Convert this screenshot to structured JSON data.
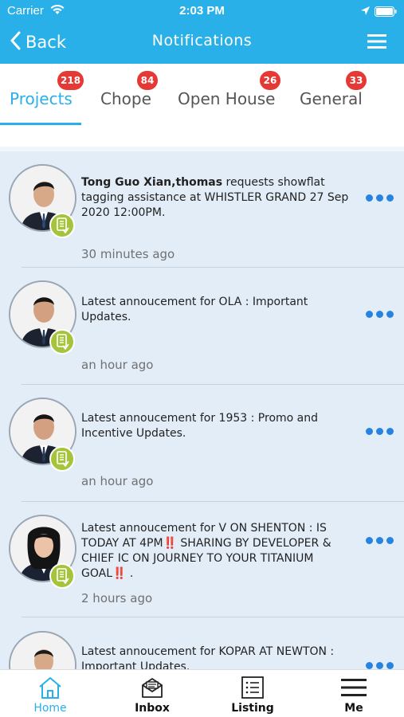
{
  "status_bar": {
    "carrier": "Carrier",
    "time": "2:03 PM"
  },
  "nav": {
    "back_label": "Back",
    "title": "Notifications"
  },
  "tabs": [
    {
      "label": "Projects",
      "badge": "218",
      "active": true
    },
    {
      "label": "Chope",
      "badge": "84",
      "active": false
    },
    {
      "label": "Open House",
      "badge": "26",
      "active": false
    },
    {
      "label": "General",
      "badge": "33",
      "active": false
    }
  ],
  "notifications": [
    {
      "bold": "Tong Guo Xian,thomas",
      "text": " requests showflat tagging assistance at WHISTLER GRAND 27 Sep 2020 12:00PM.",
      "time": "30 minutes ago"
    },
    {
      "bold": "",
      "text": "Latest annoucement for OLA : Important Updates.",
      "time": "an hour ago"
    },
    {
      "bold": "",
      "text": "Latest annoucement for 1953 : Promo and Incentive Updates.",
      "time": "an hour ago"
    },
    {
      "bold": "",
      "text": "Latest annoucement for V ON SHENTON : IS TODAY AT 4PM‼️ SHARING BY DEVELOPER & CHIEF IC ON JOURNEY TO YOUR TITANIUM GOAL‼️ .",
      "time": "2 hours ago"
    },
    {
      "bold": "",
      "text": "Latest annoucement for KOPAR AT NEWTON : Important Updates.",
      "time": ""
    }
  ],
  "bottom_nav": [
    {
      "label": "Home",
      "icon": "home-icon",
      "active": true
    },
    {
      "label": "Inbox",
      "icon": "inbox-icon",
      "active": false
    },
    {
      "label": "Listing",
      "icon": "listing-icon",
      "active": false
    },
    {
      "label": "Me",
      "icon": "menu-icon",
      "active": false
    }
  ],
  "colors": {
    "header": "#2ab0e8",
    "badge": "#e53935",
    "list_bg": "#e3edf8",
    "dots": "#2783e0",
    "tag": "#a6c33d"
  }
}
